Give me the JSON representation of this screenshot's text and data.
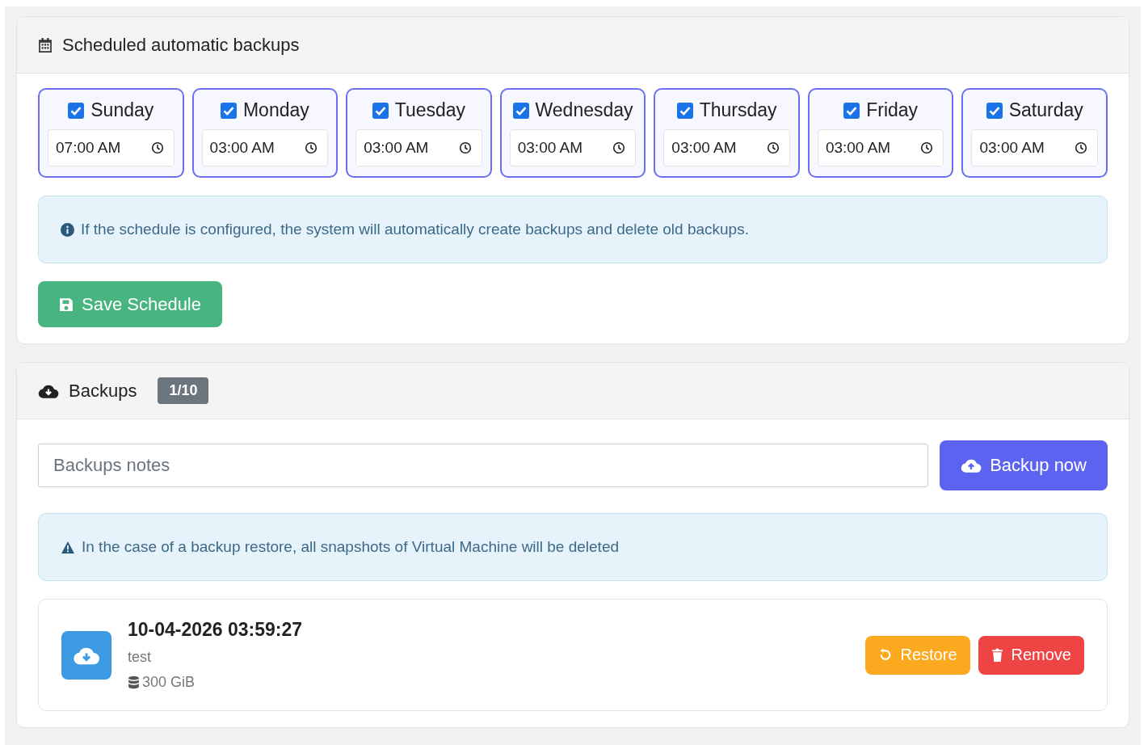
{
  "schedule": {
    "title": "Scheduled automatic backups",
    "days": [
      {
        "label": "Sunday",
        "checked": true,
        "time": "07:00 AM"
      },
      {
        "label": "Monday",
        "checked": true,
        "time": "03:00 AM"
      },
      {
        "label": "Tuesday",
        "checked": true,
        "time": "03:00 AM"
      },
      {
        "label": "Wednesday",
        "checked": true,
        "time": "03:00 AM"
      },
      {
        "label": "Thursday",
        "checked": true,
        "time": "03:00 AM"
      },
      {
        "label": "Friday",
        "checked": true,
        "time": "03:00 AM"
      },
      {
        "label": "Saturday",
        "checked": true,
        "time": "03:00 AM"
      }
    ],
    "info": "If the schedule is configured, the system will automatically create backups and delete old backups.",
    "save_button": "Save Schedule"
  },
  "backups": {
    "title": "Backups",
    "count": "1/10",
    "notes": {
      "placeholder": "Backups notes"
    },
    "backup_button": "Backup now",
    "warning": "In the case of a backup restore, all snapshots of Virtual Machine will be deleted",
    "items": [
      {
        "date": "10-04-2026 03:59:27",
        "note": "test",
        "size": "300 GiB",
        "restore": "Restore",
        "remove": "Remove"
      }
    ]
  }
}
